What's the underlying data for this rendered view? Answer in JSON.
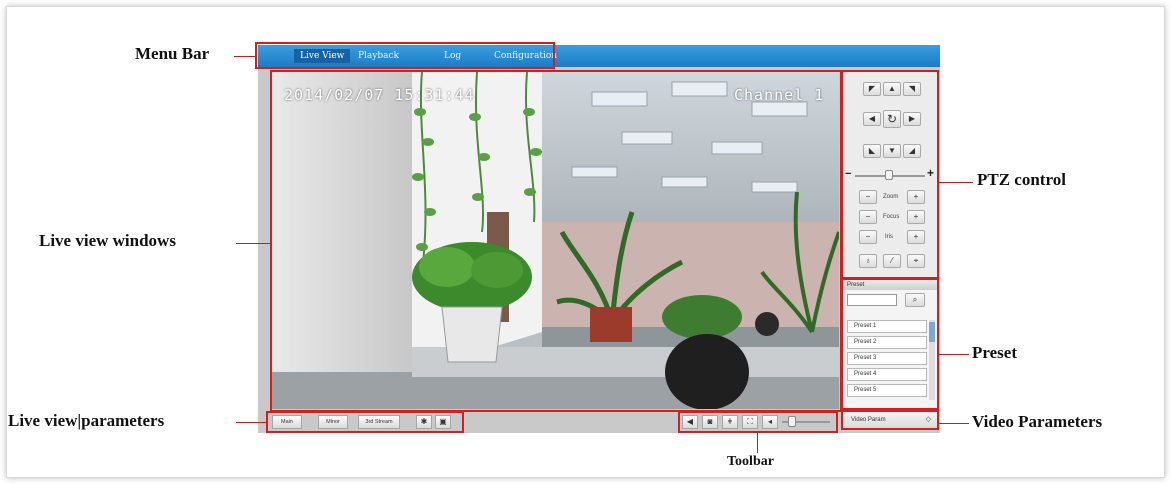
{
  "callouts": {
    "menu_bar": "Menu Bar",
    "live_view_windows": "Live view windows",
    "live_view_parameters": "Live view|parameters",
    "ptz_control": "PTZ control",
    "preset": "Preset",
    "video_parameters": "Video Parameters",
    "toolbar": "Toolbar"
  },
  "menu": {
    "items": [
      {
        "label": "Live View",
        "active": true
      },
      {
        "label": "Playback",
        "active": false
      },
      {
        "label": "Log",
        "active": false
      },
      {
        "label": "Configuration",
        "active": false
      }
    ]
  },
  "video": {
    "timestamp": "2014/02/07 15:31:44",
    "channel": "Channel 1"
  },
  "ptz": {
    "zoom_label": "Zoom",
    "focus_label": "Focus",
    "iris_label": "Iris",
    "minus": "−",
    "plus": "+"
  },
  "preset": {
    "header": "Preset",
    "items": [
      "Preset 1",
      "Preset 2",
      "Preset 3",
      "Preset 4",
      "Preset 5"
    ]
  },
  "video_parameters": {
    "label": "Video Param"
  },
  "live_params": {
    "buttons": [
      "Main",
      "Minor",
      "3rd Stream"
    ]
  },
  "colors": {
    "callout_red": "#d21f1f",
    "menu_blue": "#1c7cc4"
  }
}
